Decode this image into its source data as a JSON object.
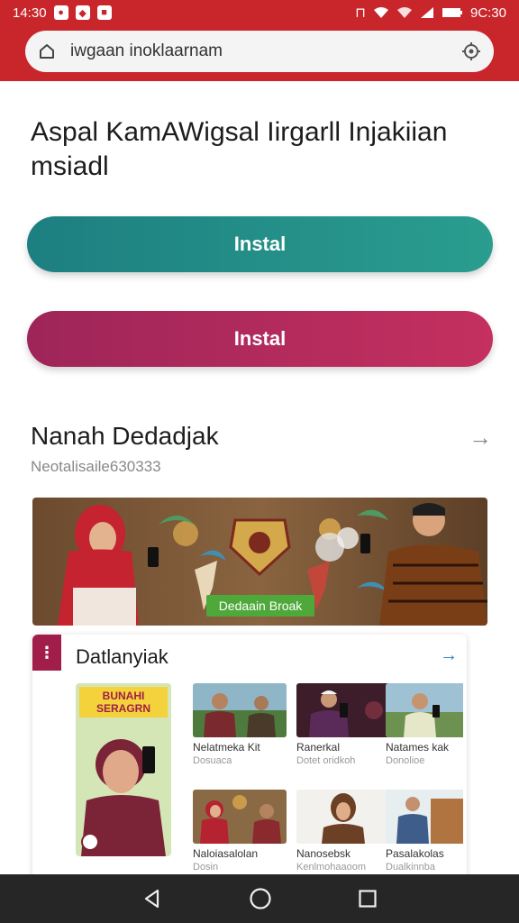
{
  "status_bar": {
    "time": "14:30",
    "right_text": "9C:30"
  },
  "url_bar": {
    "address": "iwgaan inoklaarnam"
  },
  "main": {
    "headline": "Aspal KamAWigsal Iirgarll Injakiian msiadl",
    "buttons": [
      {
        "label": "Instal",
        "color": "#2a9d8f"
      },
      {
        "label": "Instal",
        "color": "#c4305f"
      }
    ],
    "section_title": "Nanah Dedadjak",
    "section_subtitle": "Neotalisaile630333",
    "hero_badge": "Dedaain Broak"
  },
  "card": {
    "title": "Datlanyiak",
    "feature_tag": "BUNAHI SERAGRN",
    "tiles": [
      {
        "title": "Nelatmeka Kit",
        "subtitle": "Dosuaca"
      },
      {
        "title": "Ranerkal",
        "subtitle": "Dotet oridkoh"
      },
      {
        "title": "Natames kak",
        "subtitle": "Donolioe"
      },
      {
        "title": "Naloiasalolan",
        "subtitle": "Dosin"
      },
      {
        "title": "Nanosebsk",
        "subtitle": "Kenlmohaaoom"
      },
      {
        "title": "Pasalakolas",
        "subtitle": "Dualkinnba"
      }
    ]
  },
  "colors": {
    "accent": "#c8262b",
    "teal": "#2a9d8f",
    "rose": "#c4305f",
    "maroon": "#a11d4a"
  }
}
